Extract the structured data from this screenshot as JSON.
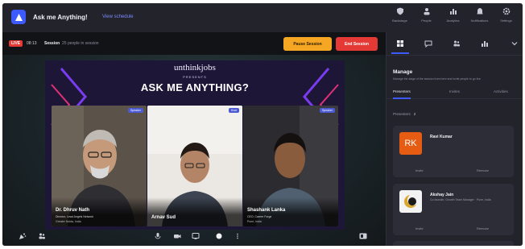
{
  "header": {
    "title": "Ask me Anything!",
    "schedule_link": "View schedule",
    "actions": [
      {
        "label": "Backstage",
        "icon": "shield-icon"
      },
      {
        "label": "People",
        "icon": "people-icon"
      },
      {
        "label": "Analytics",
        "icon": "chart-icon"
      },
      {
        "label": "Notifications",
        "icon": "bell-icon"
      },
      {
        "label": "Settings",
        "icon": "gear-icon"
      }
    ]
  },
  "session": {
    "live_badge": "LIVE",
    "timer": "08:13",
    "label": "Session",
    "people_count": "25 people in session",
    "pause_label": "Pause Session",
    "end_label": "End Session"
  },
  "stage": {
    "brand": "unthinkjobs",
    "presents": "PRESENTS",
    "title": "ASK ME ANYTHING?",
    "speakers": [
      {
        "name": "Dr. Dhruv Nath",
        "role": "Director, Lead Angels Network",
        "location": "Greater Noida, India",
        "tag": "Speaker"
      },
      {
        "name": "Arnav Sud",
        "role": "",
        "location": "",
        "tag": "Host"
      },
      {
        "name": "Shashank Lanka",
        "role": "CEO, Career Forge",
        "location": "Pune, India",
        "tag": "Speaker"
      }
    ]
  },
  "panel": {
    "heading": "Manage",
    "description": "Manage the stage of the session from here and invite people to go live",
    "subtabs": [
      "Presenters",
      "Invites",
      "Activities"
    ],
    "presenters_label": "Presenters",
    "presenters_count": "2",
    "cards": [
      {
        "initials": "RK",
        "name": "Ravi Kumar",
        "desc": "",
        "action_left": "Invite",
        "action_right": "Remove"
      },
      {
        "initials": "",
        "name": "Akshay Jain",
        "desc": "Co-founder, Growth Team Manager · Pune, India",
        "action_left": "Invite",
        "action_right": "Remove"
      }
    ]
  },
  "colors": {
    "accent": "#3d5afe",
    "live": "#e53935",
    "pause": "#f5a623",
    "card_orange": "#e65c12"
  }
}
